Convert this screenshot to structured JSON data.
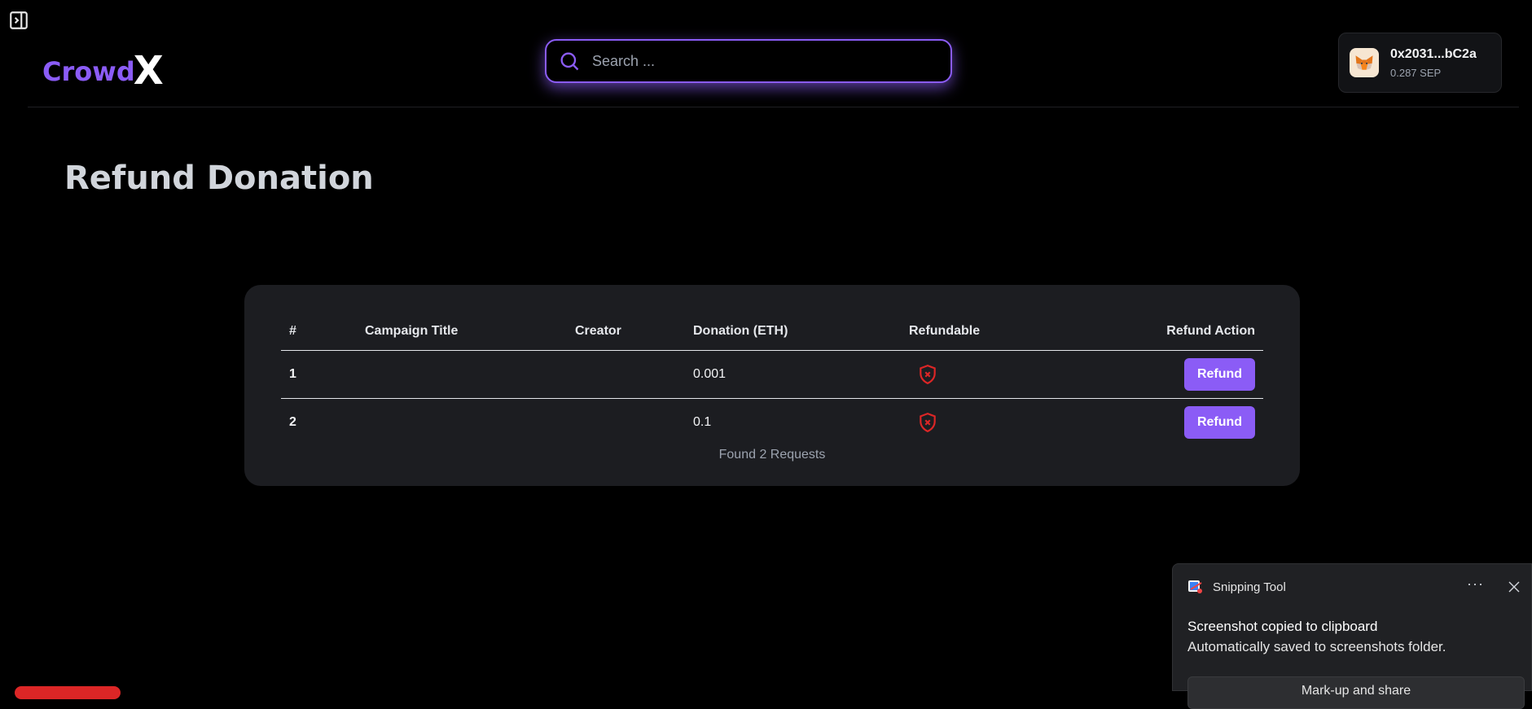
{
  "brand": {
    "name_part1": "Crowd",
    "name_part2": "X",
    "accent_color": "#8b5cf6"
  },
  "search": {
    "placeholder": "Search ..."
  },
  "wallet": {
    "address": "0x2031...bC2a",
    "balance": "0.287 SEP",
    "avatar_icon": "metamask-fox-icon"
  },
  "page": {
    "title": "Refund Donation"
  },
  "table": {
    "headers": {
      "num": "#",
      "title": "Campaign Title",
      "creator": "Creator",
      "donation": "Donation (ETH)",
      "refundable": "Refundable",
      "action": "Refund Action"
    },
    "rows": [
      {
        "num": "1",
        "title": "",
        "creator": "",
        "donation": "0.001",
        "refundable_icon": "shield-x-icon",
        "action_label": "Refund"
      },
      {
        "num": "2",
        "title": "",
        "creator": "",
        "donation": "0.1",
        "refundable_icon": "shield-x-icon",
        "action_label": "Refund"
      }
    ],
    "footer": "Found 2 Requests"
  },
  "toast": {
    "app_name": "Snipping Tool",
    "more_label": "···",
    "title": "Screenshot copied to clipboard",
    "body": "Automatically saved to screenshots folder.",
    "button_label": "Mark-up and share"
  }
}
